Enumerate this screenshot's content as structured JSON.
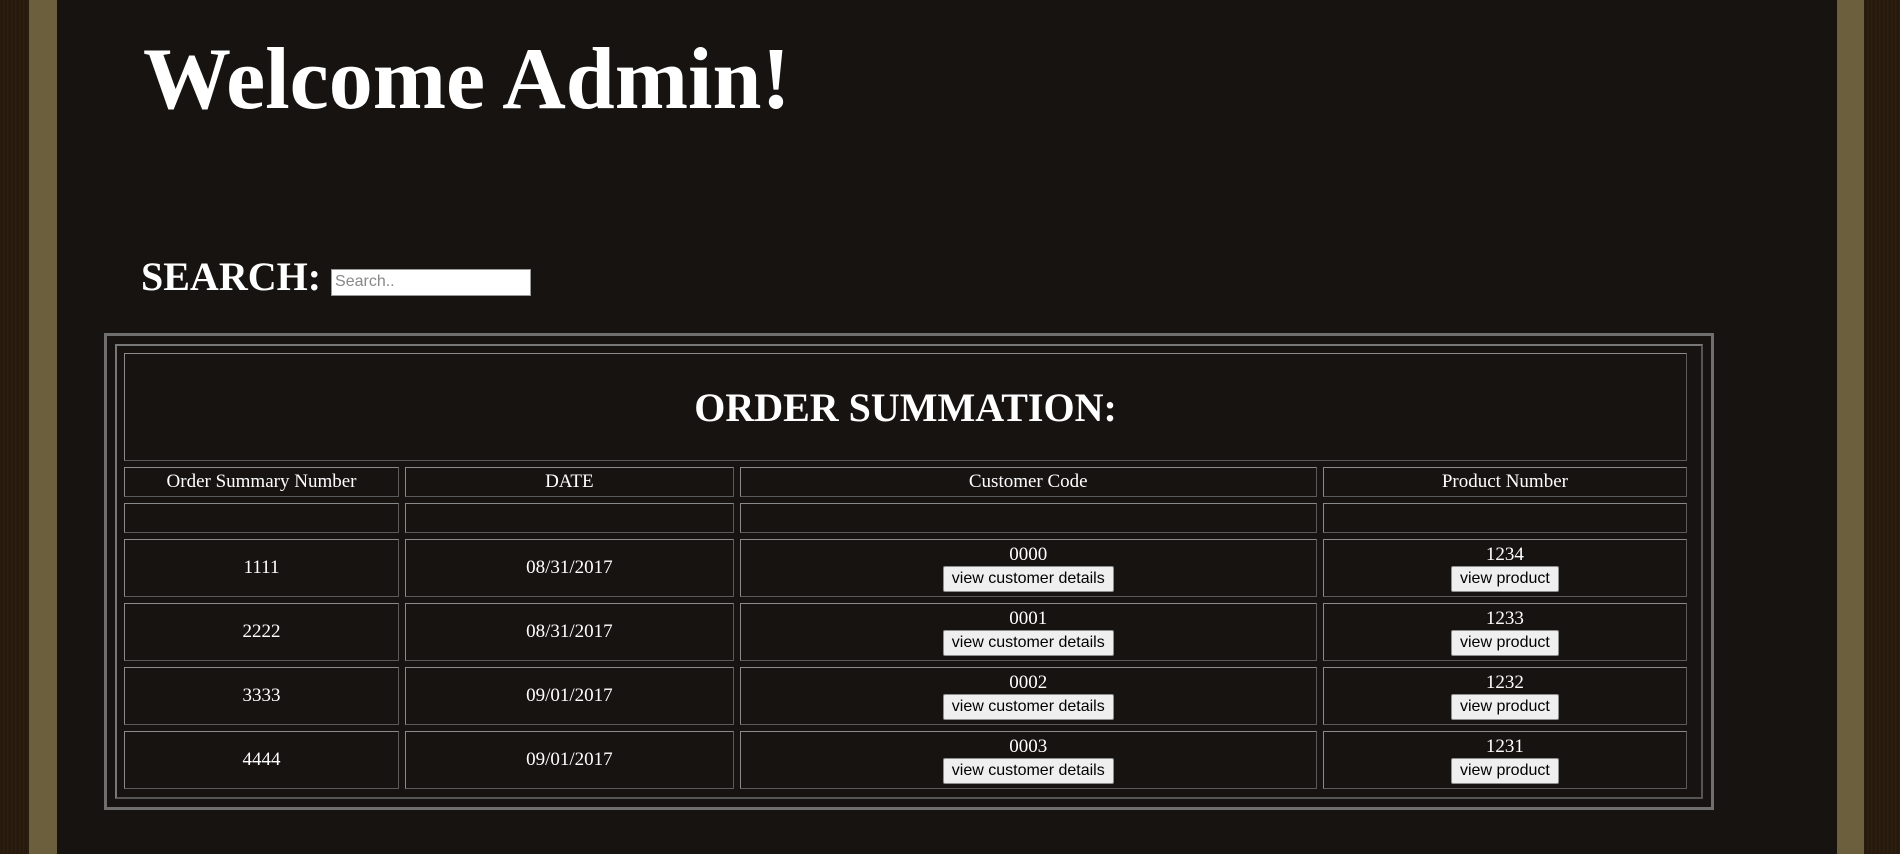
{
  "header": {
    "welcome": "Welcome Admin!"
  },
  "search": {
    "label": "SEARCH:",
    "placeholder": "Search..",
    "value": ""
  },
  "table": {
    "title": "ORDER SUMMATION:",
    "columns": [
      "Order Summary Number",
      "DATE",
      "Customer Code",
      "Product Number"
    ],
    "rows": [
      {
        "order": "1111",
        "date": "08/31/2017",
        "customer": "0000",
        "product": "1234"
      },
      {
        "order": "2222",
        "date": "08/31/2017",
        "customer": "0001",
        "product": "1233"
      },
      {
        "order": "3333",
        "date": "09/01/2017",
        "customer": "0002",
        "product": "1232"
      },
      {
        "order": "4444",
        "date": "09/01/2017",
        "customer": "0003",
        "product": "1231"
      }
    ],
    "customer_button_label": "view customer details",
    "product_button_label": "view product"
  },
  "colors": {
    "page_background": "#161311",
    "frame": "#6b5f3e",
    "text": "#ffffff"
  }
}
